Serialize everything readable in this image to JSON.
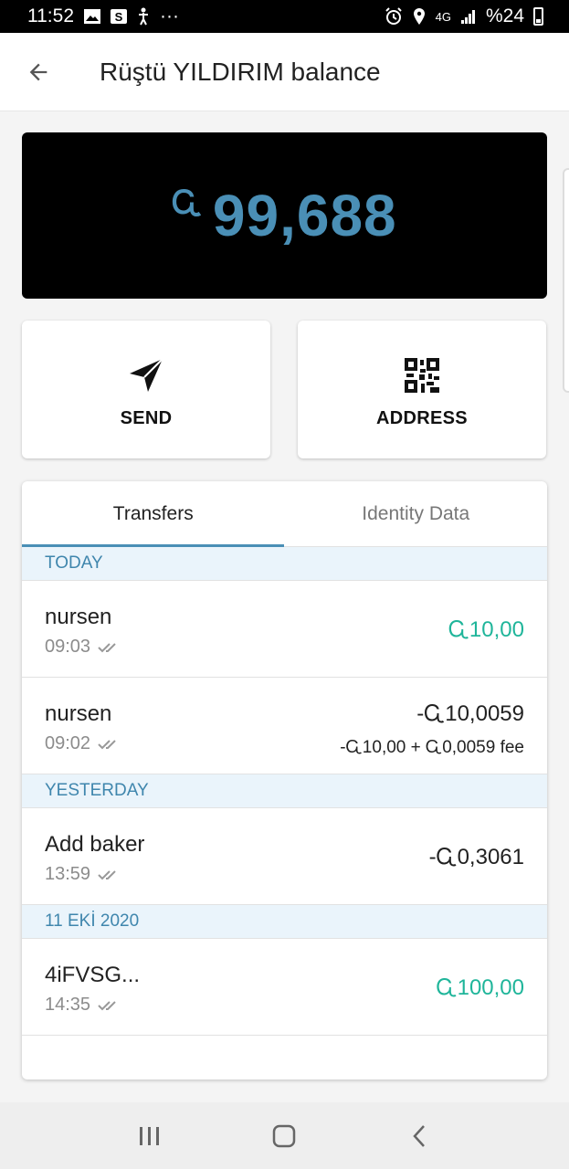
{
  "status_bar": {
    "time": "11:52",
    "dots": "···",
    "network": "4G",
    "battery_text": "%24",
    "left_icons": [
      "image-icon",
      "s-app-icon",
      "accessibility-icon"
    ],
    "right_icons": [
      "alarm-icon",
      "location-icon",
      "signal-icon",
      "battery-icon"
    ]
  },
  "app_bar": {
    "title": "Rüştü YILDIRIM balance",
    "back_icon": "arrow-back-icon"
  },
  "balance": {
    "currency_symbol": "Ꮹ",
    "amount": "99,688",
    "color": "#4a8fb6"
  },
  "actions": {
    "send_label": "SEND",
    "address_label": "ADDRESS"
  },
  "tabs": [
    {
      "label": "Transfers",
      "active": true
    },
    {
      "label": "Identity Data",
      "active": false
    }
  ],
  "sections": [
    {
      "header": "TODAY",
      "transactions": [
        {
          "name": "nursen",
          "time": "09:03",
          "amount": "Ꮹ10,00",
          "direction": "incoming"
        },
        {
          "name": "nursen",
          "time": "09:02",
          "amount": "-Ꮹ10,0059",
          "fee_detail": "-Ꮹ10,00 + Ꮹ0,0059 fee",
          "direction": "outgoing"
        }
      ]
    },
    {
      "header": "YESTERDAY",
      "transactions": [
        {
          "name": "Add baker",
          "time": "13:59",
          "amount": "-Ꮹ0,3061",
          "direction": "outgoing"
        }
      ]
    },
    {
      "header": "11 EKİ 2020",
      "transactions": [
        {
          "name": "4iFVSG...",
          "time": "14:35",
          "amount": "Ꮹ100,00",
          "direction": "incoming"
        }
      ]
    }
  ],
  "colors": {
    "accent": "#4a8fb6",
    "incoming": "#1fb59a",
    "section_bg": "#eaf4fb"
  },
  "nav_bar": {
    "icons": [
      "recent-apps-icon",
      "home-icon",
      "back-icon"
    ]
  }
}
